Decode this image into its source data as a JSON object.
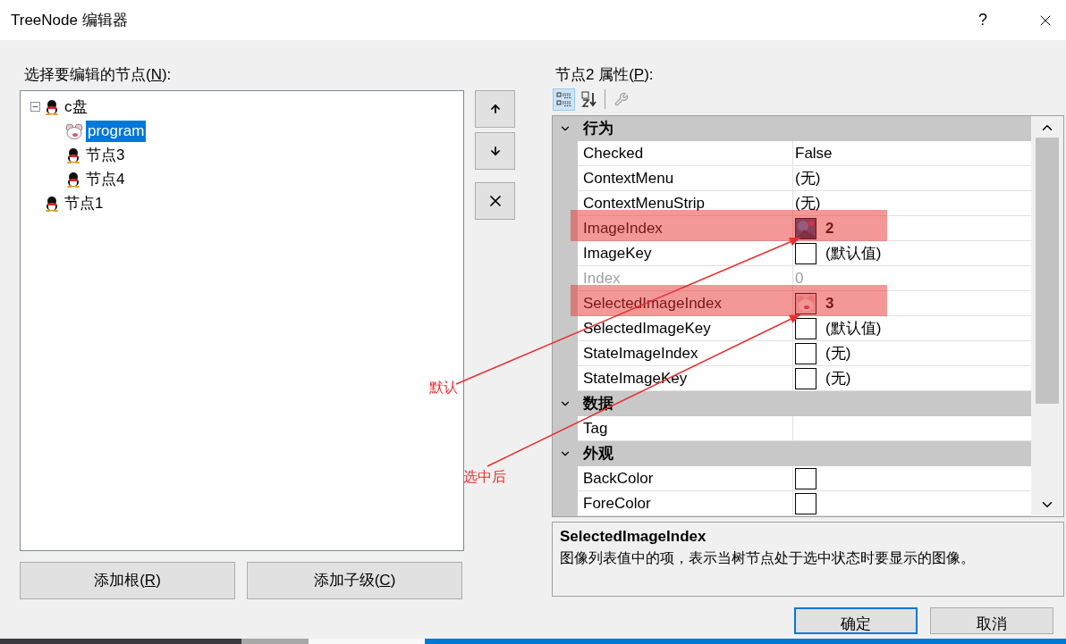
{
  "window": {
    "title": "TreeNode 编辑器",
    "help": "?"
  },
  "tree_panel": {
    "label_parts": [
      "选择要编辑的节点(",
      "N",
      "):"
    ],
    "nodes": [
      {
        "text": "c盘",
        "kind": "bird",
        "expanded": true,
        "selected": false,
        "children": [
          {
            "text": "program",
            "kind": "animal",
            "selected": true
          },
          {
            "text": "节点3",
            "kind": "bird",
            "selected": false
          },
          {
            "text": "节点4",
            "kind": "bird",
            "selected": false
          }
        ]
      },
      {
        "text": "节点1",
        "kind": "bird",
        "selected": false
      }
    ]
  },
  "side_buttons": [
    {
      "kind": "up"
    },
    {
      "kind": "down"
    },
    {
      "kind": "delete"
    }
  ],
  "tree_buttons": [
    {
      "label_parts": [
        "添加根(",
        "R",
        ")"
      ]
    },
    {
      "label_parts": [
        "添加子级(",
        "C",
        ")"
      ]
    }
  ],
  "properties": {
    "label_parts": [
      "节点2 属性(",
      "P",
      "):"
    ],
    "toolbar": [
      {
        "kind": "categorized",
        "selected": true,
        "disabled": false
      },
      {
        "kind": "alphabetical",
        "selected": false,
        "disabled": false
      },
      {
        "kind": "property-pages",
        "selected": false,
        "disabled": true
      }
    ],
    "grid": [
      {
        "kind": "category",
        "name": "行为",
        "expanded": true
      },
      {
        "kind": "property",
        "name": "Checked",
        "value": "False",
        "disabled": false
      },
      {
        "kind": "property",
        "name": "ContextMenu",
        "value": "(无)",
        "disabled": false
      },
      {
        "kind": "property",
        "name": "ContextMenuStrip",
        "value": "(无)",
        "disabled": false
      },
      {
        "kind": "property",
        "name": "ImageIndex",
        "value": "2",
        "swatch": {
          "kind": "blue-image"
        },
        "disabled": false,
        "modified": true,
        "highlighted": true
      },
      {
        "kind": "property",
        "name": "ImageKey",
        "value": "(默认值)",
        "swatch": {
          "kind": "empty"
        },
        "disabled": false
      },
      {
        "kind": "property",
        "name": "Index",
        "value": "0",
        "disabled": true
      },
      {
        "kind": "property",
        "name": "SelectedImageIndex",
        "value": "3",
        "swatch": {
          "kind": "pink-image"
        },
        "disabled": false,
        "modified": true,
        "highlighted": true
      },
      {
        "kind": "property",
        "name": "SelectedImageKey",
        "value": "(默认值)",
        "swatch": {
          "kind": "empty"
        },
        "disabled": false
      },
      {
        "kind": "property",
        "name": "StateImageIndex",
        "value": "(无)",
        "swatch": {
          "kind": "empty"
        },
        "disabled": false
      },
      {
        "kind": "property",
        "name": "StateImageKey",
        "value": "(无)",
        "swatch": {
          "kind": "empty"
        },
        "disabled": false
      },
      {
        "kind": "category",
        "name": "数据",
        "expanded": true
      },
      {
        "kind": "property",
        "name": "Tag",
        "disabled": false
      },
      {
        "kind": "category",
        "name": "外观",
        "expanded": true
      },
      {
        "kind": "property",
        "name": "BackColor",
        "swatch": {
          "kind": "empty"
        },
        "disabled": false
      },
      {
        "kind": "property",
        "name": "ForeColor",
        "swatch": {
          "kind": "empty"
        },
        "disabled": false
      }
    ],
    "description": {
      "title": "SelectedImageIndex",
      "text": "图像列表值中的项，表示当树节点处于选中状态时要显示的图像。"
    }
  },
  "dialog_buttons": [
    {
      "label": "确定",
      "default": true
    },
    {
      "label": "取消",
      "default": false
    }
  ],
  "annotations": [
    {
      "text": "默认",
      "color": "#e83030"
    },
    {
      "text": "选中后",
      "color": "#e83030"
    }
  ]
}
